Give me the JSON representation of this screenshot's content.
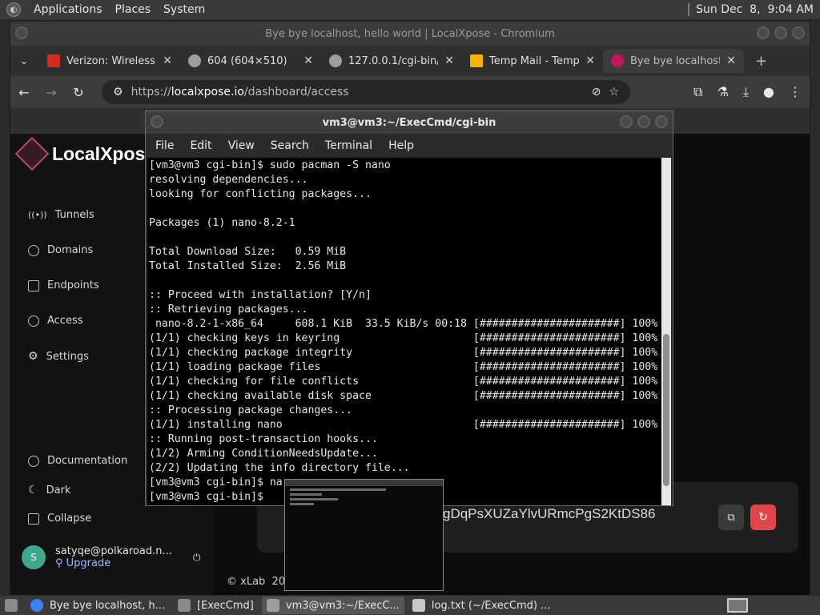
{
  "system_bar": {
    "menus": [
      "Applications",
      "Places",
      "System"
    ],
    "clock": "Sun Dec  8,  9:04 AM"
  },
  "browser": {
    "window_title": "Bye bye localhost, hello world | LocalXpose - Chromium",
    "tabs": [
      {
        "title": "Verizon: Wireless,",
        "favicon_color": "#d52b1e"
      },
      {
        "title": "604 (604×510)",
        "favicon_color": "#bdbdbd"
      },
      {
        "title": "127.0.0.1/cgi-bin/c",
        "favicon_color": "#bdbdbd"
      },
      {
        "title": "Temp Mail - Temp",
        "favicon_color": "#f5b400"
      },
      {
        "title": "Bye bye localhost,",
        "favicon_color": "#c2185b"
      }
    ],
    "url_prefix": "https://",
    "url_host": "localxpose.io",
    "url_path": "/dashboard/access"
  },
  "site": {
    "brand": "LocalXpos",
    "nav": [
      "Tunnels",
      "Domains",
      "Endpoints",
      "Access",
      "Settings"
    ],
    "bottom_nav": [
      "Documentation",
      "Dark",
      "Collapse"
    ],
    "user_email": "satyqe@polkaroad.n...",
    "avatar_letter": "S",
    "upgrade": "Upgrade",
    "access_key_partial": "gDqPsXUZaYlvURmcPgS2KtDS86",
    "footer": "xLab  20"
  },
  "terminal": {
    "title": "vm3@vm3:~/ExecCmd/cgi-bin",
    "menu": [
      "File",
      "Edit",
      "View",
      "Search",
      "Terminal",
      "Help"
    ],
    "lines": [
      "[vm3@vm3 cgi-bin]$ sudo pacman -S nano",
      "resolving dependencies...",
      "looking for conflicting packages...",
      "",
      "Packages (1) nano-8.2-1",
      "",
      "Total Download Size:   0.59 MiB",
      "Total Installed Size:  2.56 MiB",
      "",
      ":: Proceed with installation? [Y/n]",
      ":: Retrieving packages...",
      " nano-8.2-1-x86_64     608.1 KiB  33.5 KiB/s 00:18 [######################] 100%",
      "(1/1) checking keys in keyring                     [######################] 100%",
      "(1/1) checking package integrity                   [######################] 100%",
      "(1/1) loading package files                        [######################] 100%",
      "(1/1) checking for file conflicts                  [######################] 100%",
      "(1/1) checking available disk space                [######################] 100%",
      ":: Processing package changes...",
      "(1/1) installing nano                              [######################] 100%",
      ":: Running post-transaction hooks...",
      "(1/2) Arming ConditionNeedsUpdate...",
      "(2/2) Updating the info directory file...",
      "[vm3@vm3 cgi-bin]$ na",
      "[vm3@vm3 cgi-bin]$ "
    ]
  },
  "taskbar": {
    "items": [
      {
        "label": "Bye bye localhost, h...",
        "color": "#3b82f6",
        "active": false
      },
      {
        "label": "[ExecCmd]",
        "color": "#8a8a8a",
        "active": false
      },
      {
        "label": "vm3@vm3:~/ExecC...",
        "color": "#9e9e9e",
        "active": true
      },
      {
        "label": "log.txt (~/ExecCmd) ...",
        "color": "#c9c9c9",
        "active": false
      }
    ]
  }
}
